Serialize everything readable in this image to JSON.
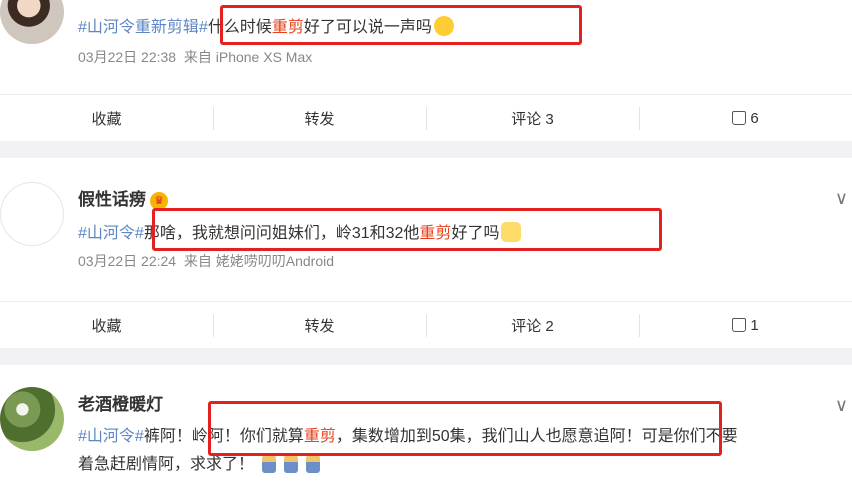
{
  "posts": [
    {
      "tag": "#山河令重新剪辑#",
      "text_a": "什么时候",
      "highlight": "重剪",
      "text_b": "好了可以说一声吗",
      "emoji": "laughing-emoji",
      "date": "03月22日 22:38",
      "source": "来自 iPhone XS Max",
      "actions": {
        "collect": "收藏",
        "repost": "转发",
        "comment": "评论 3",
        "like": "6"
      }
    },
    {
      "user": "假性话痨",
      "tag": "#山河令#",
      "text_a": "那啥，我就想问问姐妹们，岭31和32他",
      "highlight": "重剪",
      "text_b": "好了吗",
      "emoji": "fox-emoji",
      "date": "03月22日 22:24",
      "source": "来自 姥姥唠叨叨Android",
      "actions": {
        "collect": "收藏",
        "repost": "转发",
        "comment": "评论 2",
        "like": "1"
      }
    },
    {
      "user": "老酒橙暖灯",
      "tag": "#山河令#",
      "text_a": "裤阿！岭阿！你们就算",
      "highlight": "重剪",
      "text_b": "，集数增加到50集，我们山人也愿意追阿！可是你们不要",
      "text_c": "着急赶剧情阿，求求了！",
      "emoji": "pray-emoji"
    }
  ]
}
